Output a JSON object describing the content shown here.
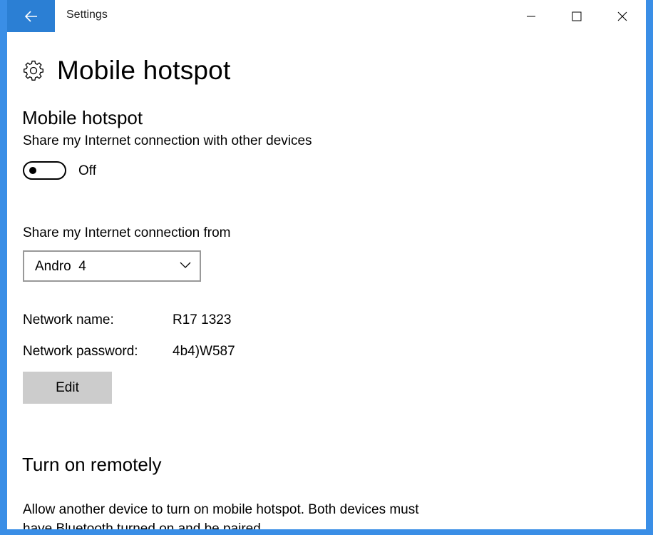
{
  "window": {
    "title": "Settings",
    "accent_color": "#2b7fd4",
    "back_icon": "back-arrow-icon",
    "controls": [
      "minimize-icon",
      "maximize-icon",
      "close-icon"
    ]
  },
  "page": {
    "title": "Mobile hotspot",
    "icon": "gear-icon"
  },
  "hotspot": {
    "section_title": "Mobile hotspot",
    "share_label": "Share my Internet connection with other devices",
    "toggle_state": "Off",
    "toggle_on": false,
    "from_label": "Share my Internet connection from",
    "from_value": "Andro  4",
    "network_name_label": "Network name:",
    "network_name_value": "R17 1323",
    "network_password_label": "Network password:",
    "network_password_value": "4b4)W587",
    "edit_label": "Edit"
  },
  "remote": {
    "section_title": "Turn on remotely",
    "description": "Allow another device to turn on mobile hotspot. Both devices must have Bluetooth turned on and be paired."
  }
}
